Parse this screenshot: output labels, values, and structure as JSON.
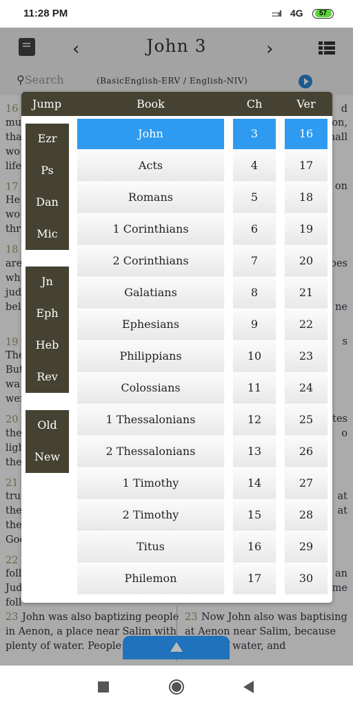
{
  "status_bar": {
    "time": "11:28 PM",
    "signal": ":::ıl",
    "network": "4G",
    "battery": "57"
  },
  "header": {
    "title": "John 3",
    "prev_icon": "chevron-left-icon",
    "next_icon": "chevron-right-icon",
    "book_icon": "book-icon",
    "menu_icon": "list-icon"
  },
  "search": {
    "placeholder": "Search",
    "translations": "(BasicEnglish-ERV / English-NIV)",
    "play_icon": "play-icon"
  },
  "background_text": {
    "left": [
      "16",
      "mu",
      "that",
      "wo",
      "life.",
      "17",
      "He",
      "wo",
      "thro",
      "18",
      "are",
      "wh",
      "judg",
      "beli",
      "19",
      "The",
      "But",
      "wa",
      "wer",
      "20",
      "the",
      "ligh",
      "the",
      "21",
      "true",
      "the",
      "the",
      "Goo",
      "22",
      "foll",
      "Jude",
      "foll"
    ],
    "right": [
      "d",
      "son,",
      "hall",
      "on",
      "oes",
      "ne",
      "s",
      "ates",
      "o",
      "at",
      "at",
      "an",
      "me"
    ],
    "verse23_left": {
      "num": "23",
      "lines": [
        "John was also baptizing people",
        "in Aenon, a place near Salim with",
        "plenty of water. People w"
      ]
    },
    "verse23_right": {
      "num": "23",
      "lines": [
        "Now John also was baptising",
        "at Aenon near Salim, because",
        "plenty of water, and"
      ]
    }
  },
  "picker": {
    "headers": {
      "jump": "Jump",
      "book": "Book",
      "ch": "Ch",
      "ver": "Ver"
    },
    "jump_groups": [
      [
        "Ezr",
        "Ps",
        "Dan",
        "Mic"
      ],
      [
        "Jn",
        "Eph",
        "Heb",
        "Rev"
      ],
      [
        "Old",
        "New"
      ]
    ],
    "books": [
      "John",
      "Acts",
      "Romans",
      "1 Corinthians",
      "2 Corinthians",
      "Galatians",
      "Ephesians",
      "Philippians",
      "Colossians",
      "1 Thessalonians",
      "2 Thessalonians",
      "1 Timothy",
      "2 Timothy",
      "Titus",
      "Philemon"
    ],
    "chapters": [
      "3",
      "4",
      "5",
      "6",
      "7",
      "8",
      "9",
      "10",
      "11",
      "12",
      "13",
      "14",
      "15",
      "16",
      "17"
    ],
    "verses": [
      "16",
      "17",
      "18",
      "19",
      "20",
      "21",
      "22",
      "23",
      "24",
      "25",
      "26",
      "27",
      "28",
      "29",
      "30"
    ],
    "selected": {
      "book": "John",
      "chapter": "3",
      "verse": "16"
    },
    "colors": {
      "header": "#454232",
      "selected": "#2e9bf0"
    }
  },
  "bottom": {
    "expand_icon": "triangle-up-icon"
  },
  "nav": {
    "recent_icon": "square-icon",
    "home_icon": "circle-icon",
    "back_icon": "back-triangle-icon"
  }
}
